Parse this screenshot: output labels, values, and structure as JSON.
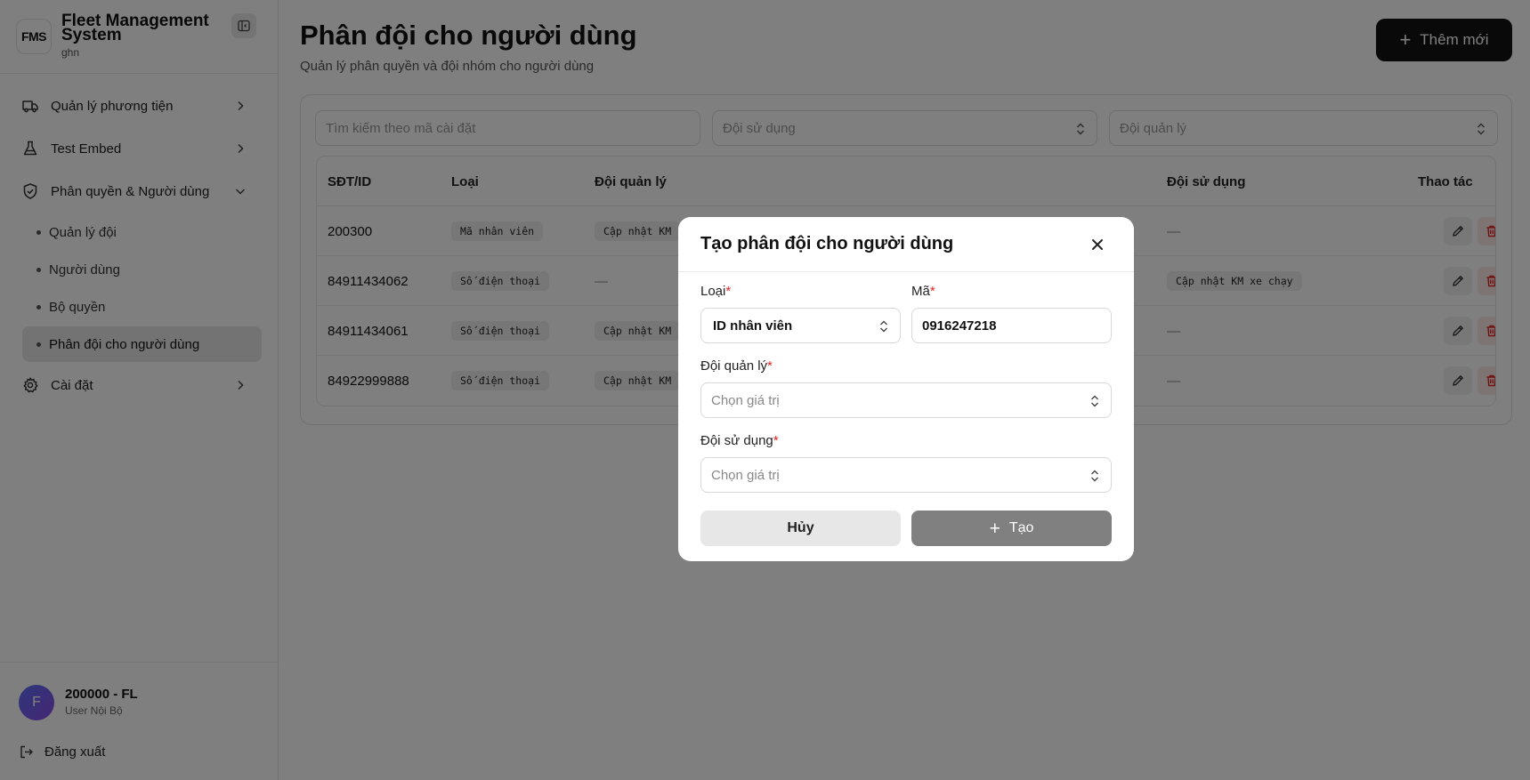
{
  "brand": {
    "logo": "FMS",
    "title": "Fleet Management System",
    "subtitle": "ghn"
  },
  "sidebar": {
    "items": [
      {
        "label": "Quản lý phương tiện",
        "icon": "truck-icon"
      },
      {
        "label": "Test Embed",
        "icon": "flask-icon"
      },
      {
        "label": "Phân quyền & Người dùng",
        "icon": "shield-icon"
      },
      {
        "label": "Cài đặt",
        "icon": "gear-icon"
      }
    ],
    "subitems": [
      {
        "label": "Quản lý đội"
      },
      {
        "label": "Người dùng"
      },
      {
        "label": "Bộ quyền"
      },
      {
        "label": "Phân đội cho người dùng"
      }
    ]
  },
  "user": {
    "initial": "F",
    "name": "200000 - FL",
    "role": "User Nội Bộ",
    "logout": "Đăng xuất"
  },
  "page": {
    "title": "Phân đội cho người dùng",
    "subtitle": "Quản lý phân quyền và đội nhóm cho người dùng",
    "add_button": "Thêm mới"
  },
  "filters": {
    "search_placeholder": "Tìm kiếm theo mã cài đặt",
    "using_team_placeholder": "Đội sử dụng",
    "managing_team_placeholder": "Đội quản lý"
  },
  "table": {
    "headers": [
      "SĐT/ID",
      "Loại",
      "Đội quản lý",
      "Đội sử dụng",
      "Thao tác"
    ],
    "rows": [
      {
        "id": "200300",
        "type": "Mã nhân viên",
        "manage": "Cập nhật KM",
        "use": "—"
      },
      {
        "id": "84911434062",
        "type": "Số điện thoại",
        "manage": "—",
        "use": "Cập nhật KM xe chạy"
      },
      {
        "id": "84911434061",
        "type": "Số điện thoại",
        "manage": "Cập nhật KM",
        "use": "—"
      },
      {
        "id": "84922999888",
        "type": "Số điện thoại",
        "manage": "Cập nhật KM",
        "use": "—"
      }
    ]
  },
  "modal": {
    "title": "Tạo phân đội cho người dùng",
    "type_label": "Loại",
    "type_value": "ID nhân viên",
    "code_label": "Mã",
    "code_value": "0916247218",
    "manage_label": "Đội quản lý",
    "manage_placeholder": "Chọn giá trị",
    "use_label": "Đội sử dụng",
    "use_placeholder": "Chọn giá trị",
    "required_mark": "*",
    "cancel": "Hủy",
    "create": "Tạo"
  }
}
